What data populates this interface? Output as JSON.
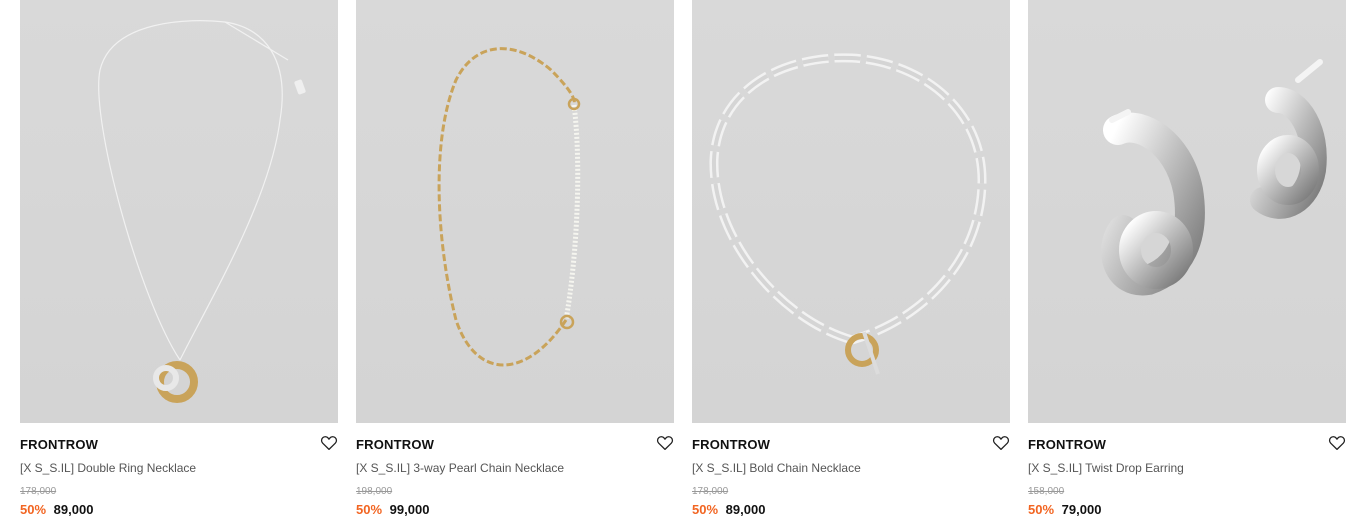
{
  "products": [
    {
      "brand": "FRONTROW",
      "name": "[X S_S.IL] Double Ring Necklace",
      "original_price": "178,000",
      "discount": "50%",
      "sale_price": "89,000",
      "wishlist_icon": "heart-outline-icon"
    },
    {
      "brand": "FRONTROW",
      "name": "[X S_S.IL] 3-way Pearl Chain Necklace",
      "original_price": "198,000",
      "discount": "50%",
      "sale_price": "99,000",
      "wishlist_icon": "heart-outline-icon"
    },
    {
      "brand": "FRONTROW",
      "name": "[X S_S.IL] Bold Chain Necklace",
      "original_price": "178,000",
      "discount": "50%",
      "sale_price": "89,000",
      "wishlist_icon": "heart-outline-icon"
    },
    {
      "brand": "FRONTROW",
      "name": "[X S_S.IL] Twist Drop Earring",
      "original_price": "158,000",
      "discount": "50%",
      "sale_price": "79,000",
      "wishlist_icon": "heart-outline-icon"
    }
  ],
  "colors": {
    "discount": "#f26522",
    "image_bg": "#d6d6d6",
    "brand_text": "#111111",
    "name_text": "#555555",
    "original_price_text": "#999999"
  }
}
